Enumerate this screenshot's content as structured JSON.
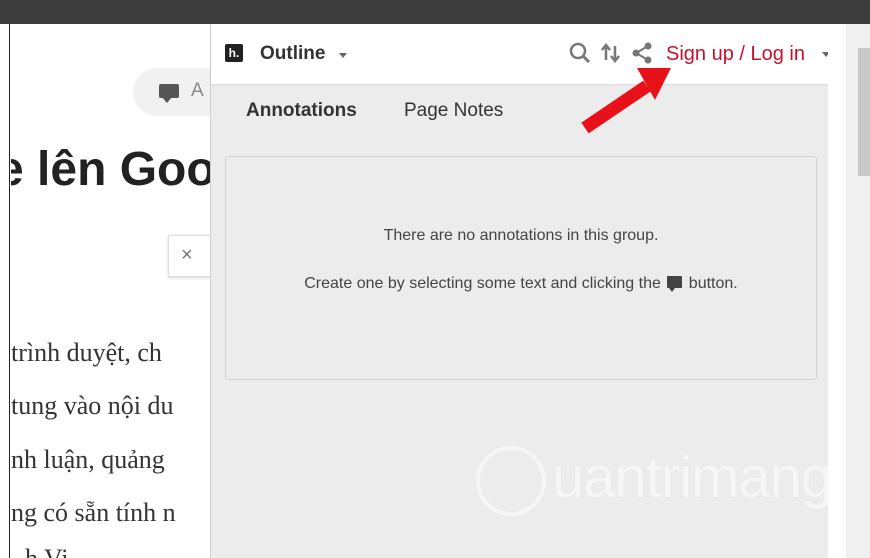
{
  "article": {
    "annotate_label": "A",
    "headline": "e lên Goo",
    "close_symbol": "×",
    "lines": [
      "trình duyệt, ch",
      "tung vào nội du",
      "nh luận, quảng",
      "ng có sẵn tính n",
      "h Vi"
    ]
  },
  "sidebar": {
    "logo": "h.",
    "group_label": "Outline",
    "login_label": "Sign up / Log in",
    "tabs": [
      {
        "label": "Annotations",
        "active": true
      },
      {
        "label": "Page Notes",
        "active": false
      }
    ],
    "empty_state": {
      "line1": "There are no annotations in this group.",
      "line2_prefix": "Create one by selecting some text and clicking the",
      "line2_suffix": "button."
    },
    "login_color": "#c8102e"
  },
  "watermark": {
    "text": "uantrimang"
  },
  "icons": [
    "search-icon",
    "sort-icon",
    "share-icon",
    "chevron-down-icon",
    "annotate-icon",
    "arrow-pointer"
  ]
}
